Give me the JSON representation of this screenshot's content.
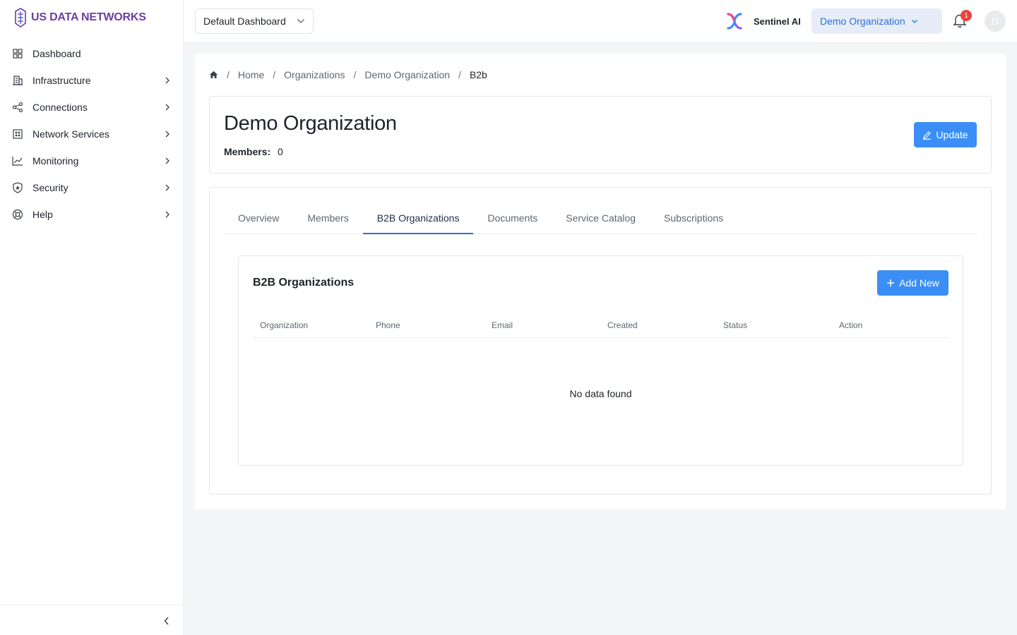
{
  "brand": {
    "name": "US DATA NETWORKS",
    "color": "#6b3fa0"
  },
  "sidebar": {
    "items": [
      {
        "label": "Dashboard",
        "icon": "grid-icon",
        "has_children": false
      },
      {
        "label": "Infrastructure",
        "icon": "building-icon",
        "has_children": true
      },
      {
        "label": "Connections",
        "icon": "share-icon",
        "has_children": true
      },
      {
        "label": "Network Services",
        "icon": "server-icon",
        "has_children": true
      },
      {
        "label": "Monitoring",
        "icon": "chart-line-icon",
        "has_children": true
      },
      {
        "label": "Security",
        "icon": "shield-icon",
        "has_children": true
      },
      {
        "label": "Help",
        "icon": "lifebuoy-icon",
        "has_children": true
      }
    ]
  },
  "header": {
    "dashboard_select": "Default Dashboard",
    "sentinel_label": "Sentinel AI",
    "org_select": "Demo Organization",
    "notification_count": "1",
    "avatar_initial": "D"
  },
  "breadcrumb": {
    "items": [
      "Home",
      "Organizations",
      "Demo Organization"
    ],
    "current": "B2b"
  },
  "org": {
    "title": "Demo Organization",
    "members_label": "Members:",
    "members_value": "0",
    "update_label": "Update"
  },
  "tabs": [
    "Overview",
    "Members",
    "B2B Organizations",
    "Documents",
    "Service Catalog",
    "Subscriptions"
  ],
  "active_tab": "B2B Organizations",
  "b2b": {
    "title": "B2B Organizations",
    "add_label": "Add New",
    "columns": [
      "Organization",
      "Phone",
      "Email",
      "Created",
      "Status",
      "Action"
    ],
    "empty_text": "No data found"
  },
  "colors": {
    "primary": "#3b8ef5",
    "active_tab": "#2f6fd6",
    "badge": "#e5433f"
  }
}
